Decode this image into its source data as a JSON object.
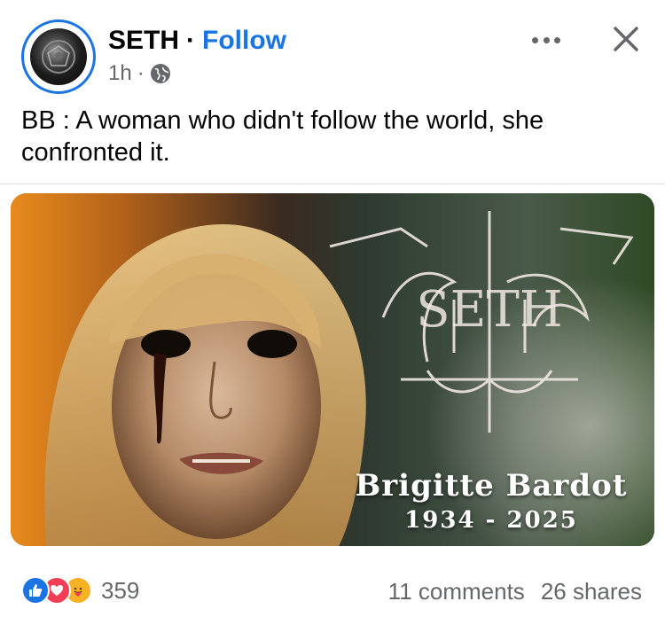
{
  "header": {
    "author": "SETH",
    "separator": "·",
    "follow_label": "Follow",
    "time": "1h",
    "meta_separator": "·",
    "privacy_icon": "globe-icon",
    "more_icon": "more-horizontal-icon",
    "close_icon": "close-icon"
  },
  "post": {
    "text": "BB : A woman who didn't follow the world, she confronted it."
  },
  "media": {
    "caption_name": "Brigitte Bardot",
    "caption_years": "1934 - 2025",
    "logo_text": "SETH"
  },
  "footer": {
    "reaction_icons": [
      "like-icon",
      "love-icon",
      "care-icon"
    ],
    "reaction_count": "359",
    "comments": "11 comments",
    "shares": "26 shares"
  },
  "colors": {
    "accent": "#1b74e4",
    "secondary_text": "#65676b",
    "like": "#1b74e4",
    "love": "#f33e58",
    "care": "#f7b125"
  }
}
